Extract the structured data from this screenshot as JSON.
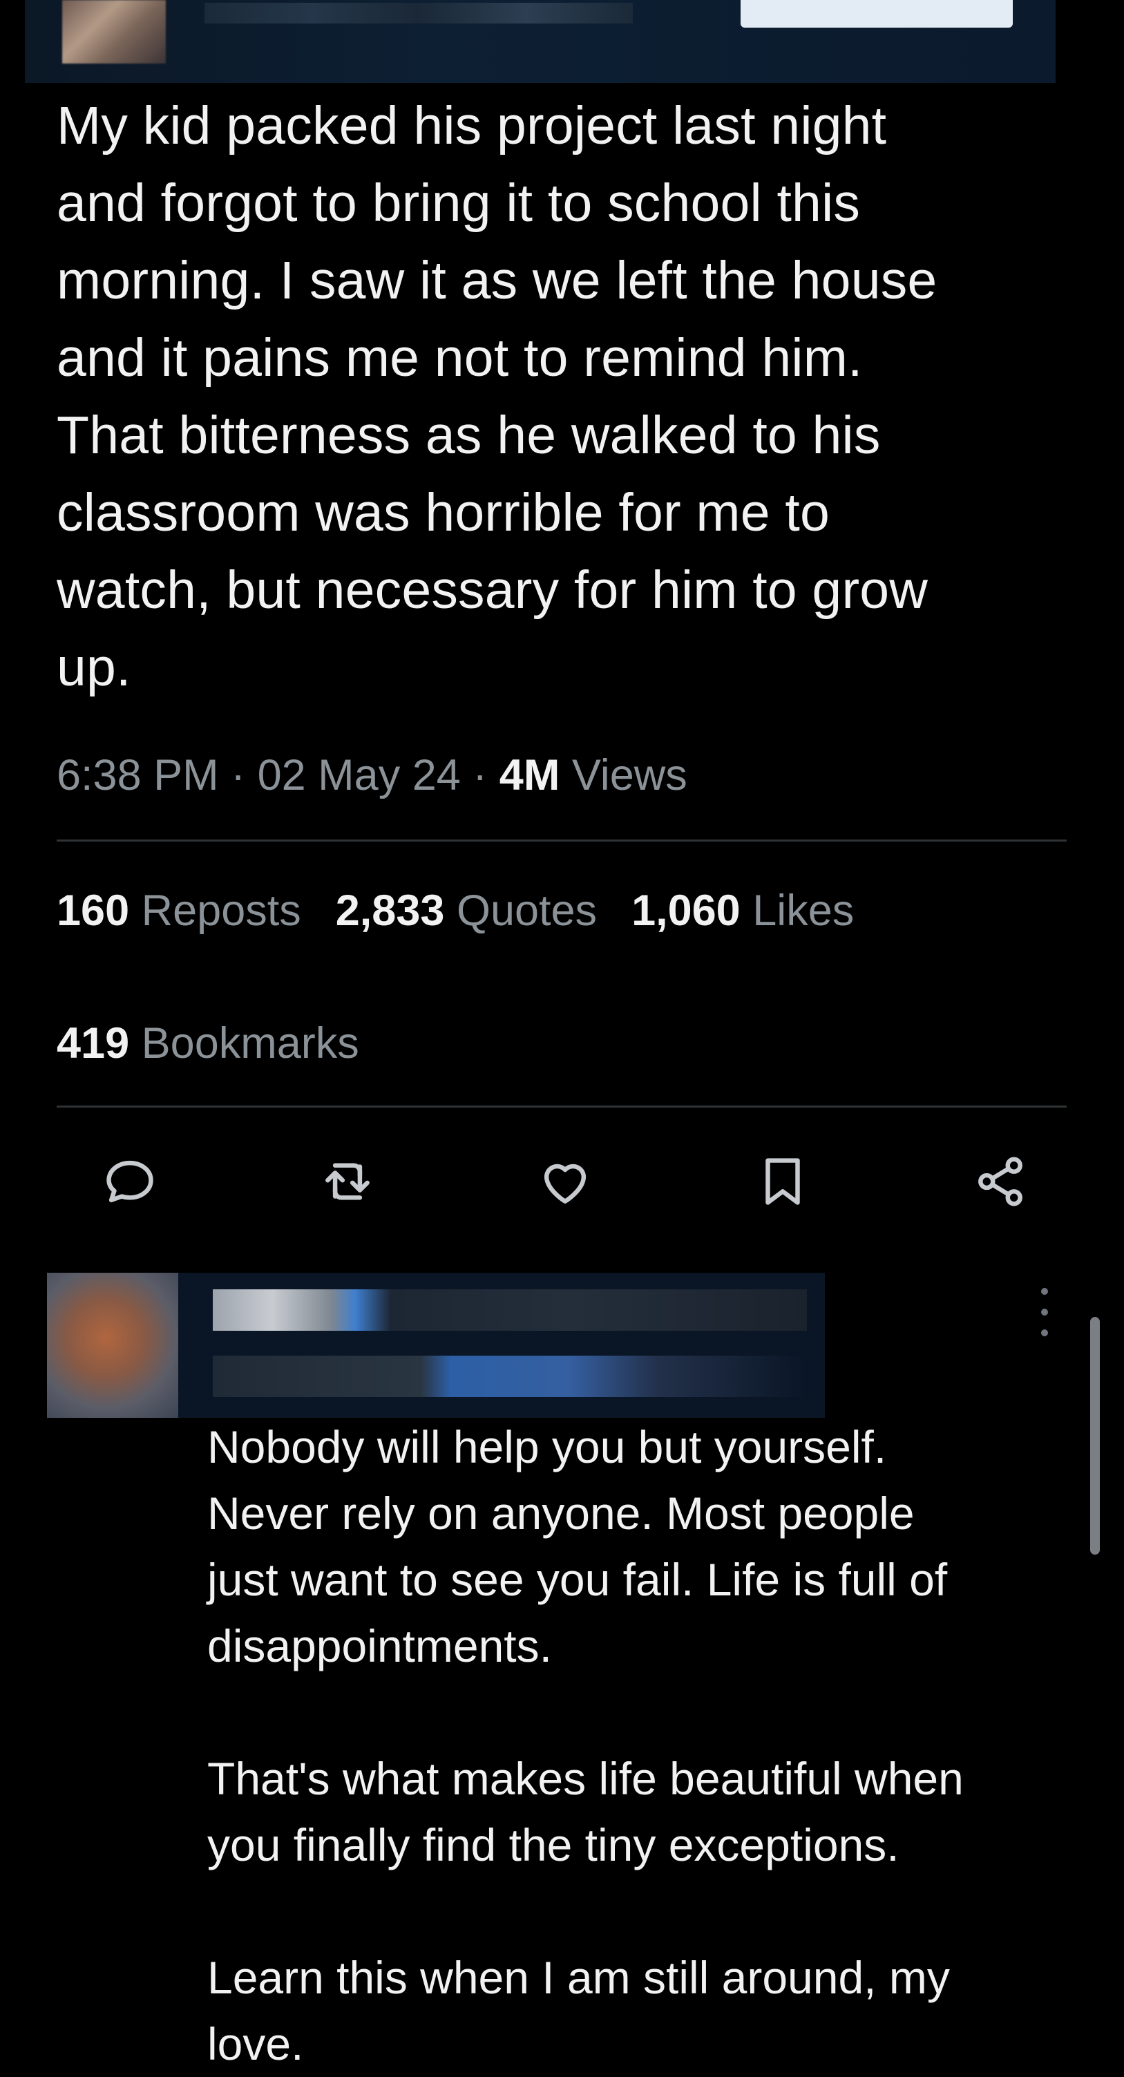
{
  "post": {
    "text": "My kid packed his project last night\nand forgot to bring it to school this\nmorning. I saw it as we left the house\nand it pains me not to remind him.\nThat bitterness as he walked to his\nclassroom was horrible for me to\nwatch, but necessary for him to grow\nup.",
    "time": "6:38 PM · 02 May 24 · ",
    "views_count": "4M",
    "views_label": " Views"
  },
  "stats": {
    "reposts": {
      "count": "160",
      "label": "Reposts"
    },
    "quotes": {
      "count": "2,833",
      "label": "Quotes"
    },
    "likes": {
      "count": "1,060",
      "label": "Likes"
    },
    "bookmarks": {
      "count": "419",
      "label": "Bookmarks"
    }
  },
  "actions": [
    {
      "icon": "reply-icon"
    },
    {
      "icon": "repost-icon"
    },
    {
      "icon": "like-icon"
    },
    {
      "icon": "bookmark-icon"
    },
    {
      "icon": "share-icon"
    }
  ],
  "reply": {
    "text": "Nobody will help you but yourself.\nNever rely on anyone. Most people\njust want to see you fail. Life is full of\ndisappointments.\n\nThat's what makes life beautiful when\nyou finally find the tiny exceptions.\n\nLearn this when I am still around, my\nlove."
  },
  "colors": {
    "background": "#000000",
    "text": "#f2f2f2",
    "muted": "#8b9298",
    "divider": "#2f3336"
  }
}
